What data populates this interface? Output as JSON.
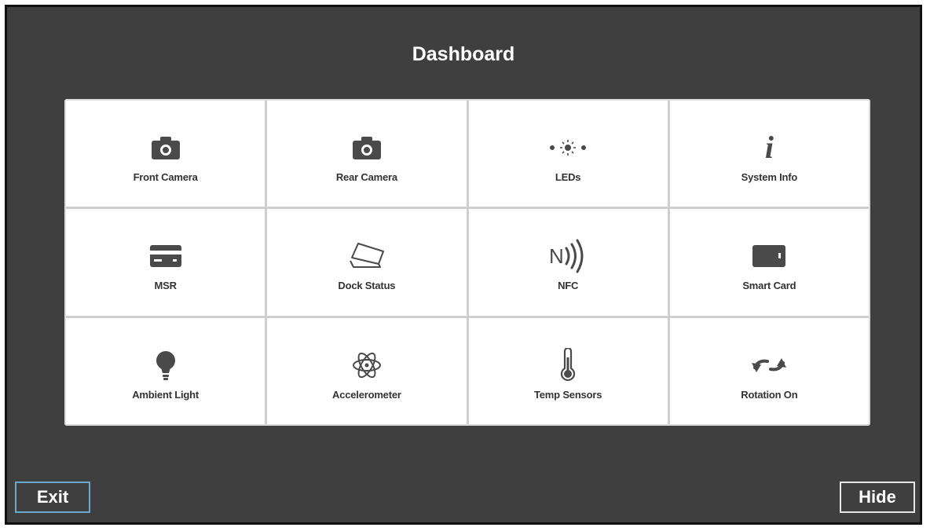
{
  "title": "Dashboard",
  "tiles": [
    {
      "label": "Front Camera",
      "icon": "camera-icon"
    },
    {
      "label": "Rear Camera",
      "icon": "camera-icon"
    },
    {
      "label": "LEDs",
      "icon": "led-icon"
    },
    {
      "label": "System Info",
      "icon": "info-icon"
    },
    {
      "label": "MSR",
      "icon": "credit-card-icon"
    },
    {
      "label": "Dock Status",
      "icon": "dock-icon"
    },
    {
      "label": "NFC",
      "icon": "nfc-icon"
    },
    {
      "label": "Smart Card",
      "icon": "smart-card-icon"
    },
    {
      "label": "Ambient Light",
      "icon": "lightbulb-icon"
    },
    {
      "label": "Accelerometer",
      "icon": "atom-icon"
    },
    {
      "label": "Temp Sensors",
      "icon": "thermometer-icon"
    },
    {
      "label": "Rotation On",
      "icon": "rotation-icon"
    }
  ],
  "buttons": {
    "exit": "Exit",
    "hide": "Hide"
  },
  "colors": {
    "background": "#3f3f3f",
    "tile": "#ffffff",
    "icon": "#4a4a4a",
    "exit_border": "#6aa8cc"
  }
}
